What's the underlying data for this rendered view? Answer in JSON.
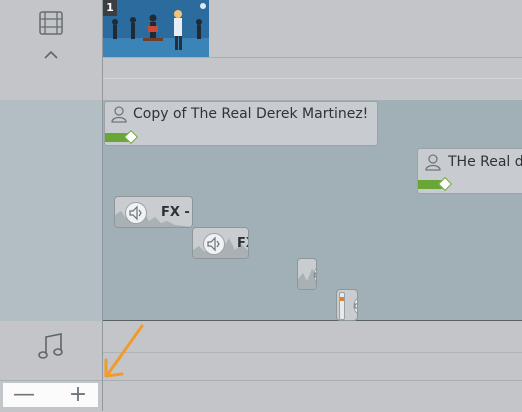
{
  "video_track": {
    "thumbnail_badge": "1"
  },
  "clips": [
    {
      "title": "Copy of The Real Derek Martinez!"
    },
    {
      "title": "THe Real de"
    }
  ],
  "audio_clips": [
    {
      "label": "FX - I"
    },
    {
      "label": "FX"
    },
    {
      "label": ""
    },
    {
      "label": ""
    }
  ],
  "zoom": {
    "minus": "—",
    "plus": "+"
  },
  "colors": {
    "progress": "#6aa636",
    "annotation_arrow": "#f19b2c"
  },
  "icons": [
    "film-strip-icon",
    "chevron-up-icon",
    "music-note-icon",
    "user-icon",
    "speaker-icon",
    "orange-arrow-annotation"
  ]
}
